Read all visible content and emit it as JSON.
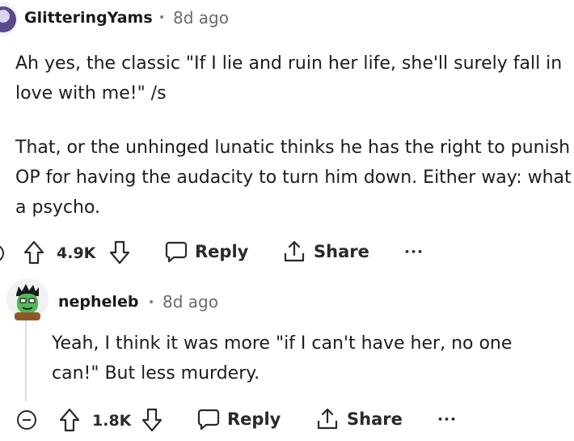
{
  "comments": [
    {
      "username": "GlitteringYams",
      "time": "8d ago",
      "paragraphs": [
        "Ah yes, the classic \"If I lie and ruin her life, she'll surely fall in love with me!\" /s",
        "That, or the unhinged lunatic thinks he has the right to punish OP for having the audacity to turn him down. Either way: what a psycho."
      ],
      "votes": "4.9K",
      "reply_label": "Reply",
      "share_label": "Share",
      "more_label": "•••"
    },
    {
      "username": "nepheleb",
      "time": "8d ago",
      "paragraphs": [
        "Yeah, I think it was more \"if I can't have her, no one can!\" But less murdery."
      ],
      "votes": "1.8K",
      "reply_label": "Reply",
      "share_label": "Share",
      "more_label": "•••"
    }
  ],
  "separator": "•",
  "colors": {
    "avatar_green": "#52b85a",
    "avatar_bg": "#f2f2f2",
    "text": "#1c1c1c",
    "meta": "#6a6a6a"
  }
}
